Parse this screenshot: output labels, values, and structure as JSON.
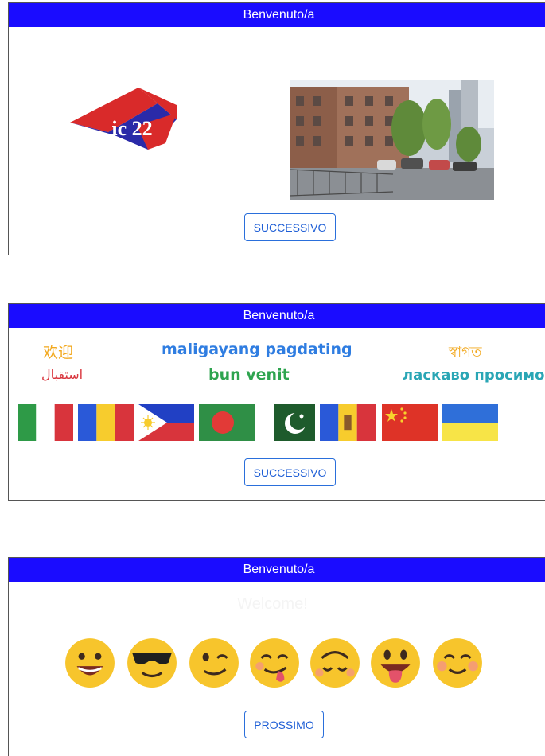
{
  "panels": [
    {
      "header": "Benvenuto/a",
      "button": "SUCCESSIVO"
    },
    {
      "header": "Benvenuto/a",
      "button": "SUCCESSIVO"
    },
    {
      "header": "Benvenuto/a",
      "button": "PROSSIMO",
      "welcome": "Welcome!"
    }
  ],
  "logo": {
    "text": "ic 22"
  },
  "welcomes": {
    "chinese": "欢迎",
    "filipino": "maligayang pagdating",
    "bengali": "স্বাগত",
    "arabic": "استقبال",
    "romanian": "bun venit",
    "ukrainian": "ласкаво просимо"
  },
  "colors": {
    "header_bg": "#1a0cff",
    "button_text": "#1f5fd6",
    "chinese": "#f2a81d",
    "filipino": "#2f7de1",
    "bengali": "#f2a81d",
    "arabic": "#d9363e",
    "romanian": "#2ea44f",
    "ukrainian": "#2aa6b5"
  },
  "flags": [
    "italy-flag",
    "romania-flag",
    "philippines-flag",
    "bangladesh-flag",
    "pakistan-flag",
    "moldova-flag",
    "china-flag",
    "ukraine-flag"
  ],
  "emojis": [
    "grinning-face-icon",
    "sunglasses-face-icon",
    "winking-face-icon",
    "tongue-out-face-icon",
    "upside-down-face-icon",
    "tongue-face-icon",
    "blushing-face-icon"
  ]
}
